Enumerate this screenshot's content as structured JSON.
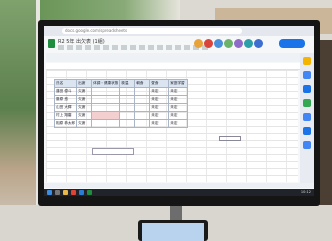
{
  "browser": {
    "url": "docs.google.com/spreadsheets"
  },
  "sheet": {
    "title": "R2 5年 出欠表 (1組)",
    "header": [
      "氏名",
      "出席",
      "体調・健康状態",
      "検温",
      "朝食",
      "昼食",
      "家庭学習"
    ],
    "rows": [
      [
        "蓮田 優斗",
        "欠席",
        "",
        "",
        "",
        "未定",
        "未定"
      ],
      [
        "藤原 悠",
        "欠席",
        "",
        "",
        "",
        "未定",
        "未定"
      ],
      [
        "山田 大輝",
        "欠席",
        "",
        "",
        "",
        "未定",
        "未定"
      ],
      [
        "村上 翔磨",
        "欠席",
        "",
        "",
        "",
        "未定",
        "未定"
      ],
      [
        "相原 恭太郎",
        "欠席",
        "",
        "",
        "",
        "未定",
        "未定"
      ]
    ],
    "highlight_color": "#f3d0cf"
  },
  "taskbar": {
    "clock": "10:12"
  }
}
